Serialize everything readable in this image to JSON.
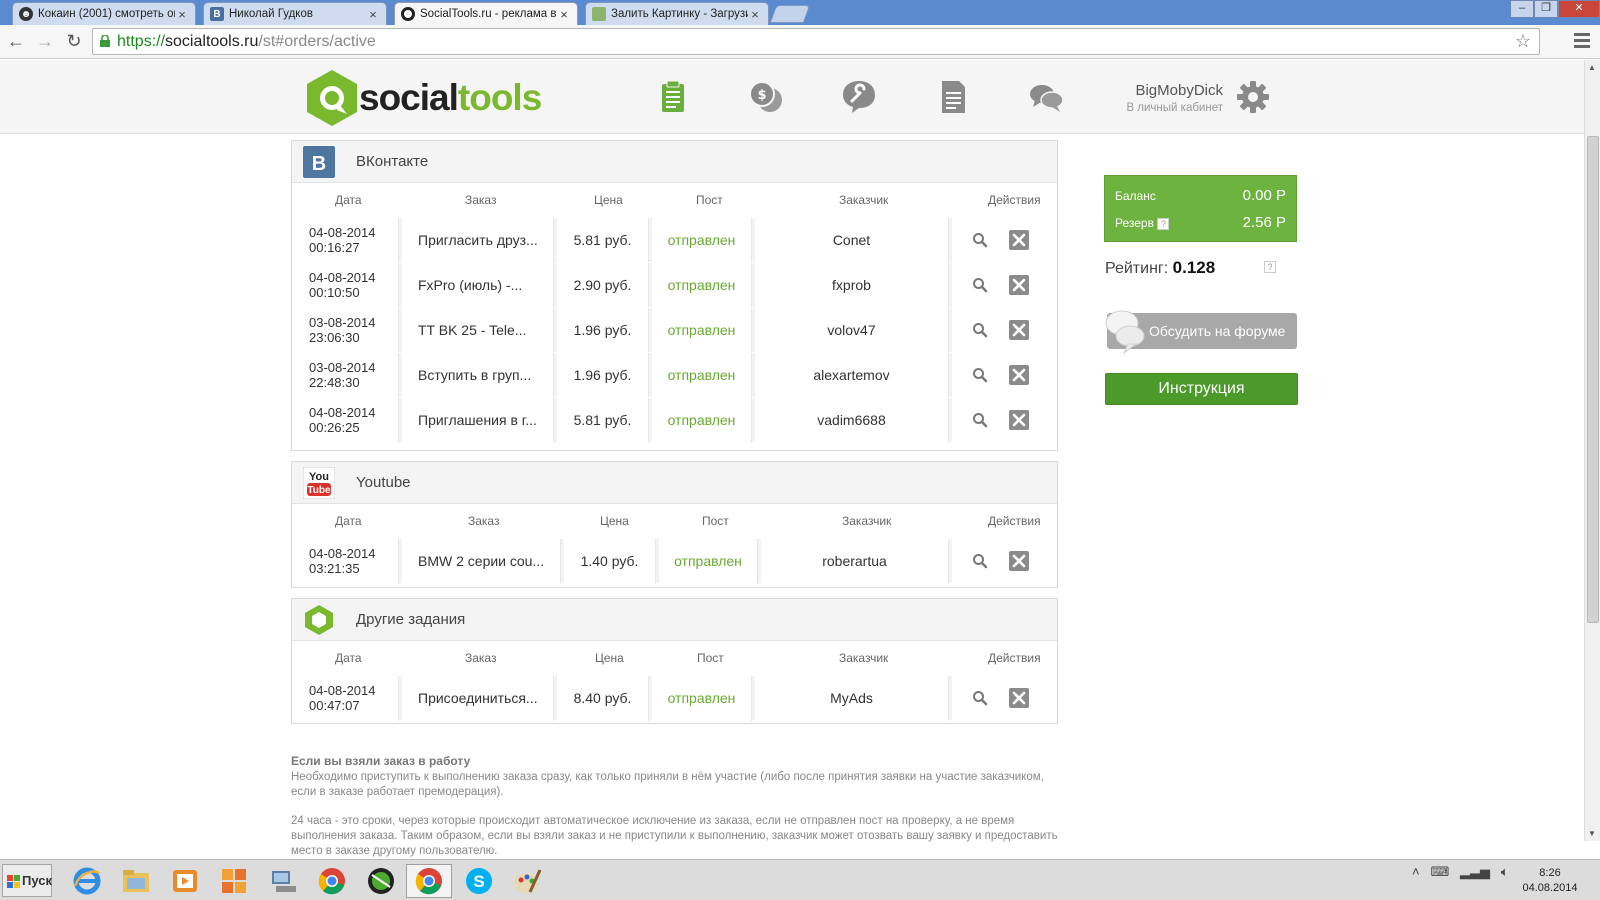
{
  "browser": {
    "tabs": [
      {
        "title": "Кокаин (2001) смотреть он",
        "close": "×"
      },
      {
        "title": "Николай Гудков",
        "close": "×"
      },
      {
        "title": "SocialTools.ru - реклама в с",
        "close": "×"
      },
      {
        "title": "Залить Картинку - Загрузи",
        "close": "×"
      }
    ],
    "url_proto": "https://",
    "url_host": "socialtools.ru",
    "url_path": "/st#orders/active"
  },
  "header": {
    "logo_part1": "social",
    "logo_part2": "tools",
    "user_name": "BigMobyDick",
    "user_link": "В личный кабинет"
  },
  "columns": {
    "date": "Дата",
    "order": "Заказ",
    "price": "Цена",
    "post": "Пост",
    "customer": "Заказчик",
    "actions": "Действия"
  },
  "sections": {
    "vk": {
      "title": "ВКонтакте",
      "rows": [
        {
          "date": "04-08-2014",
          "time": "00:16:27",
          "order": "Пригласить друз...",
          "price": "5.81 руб.",
          "post": "отправлен",
          "customer": "Conet"
        },
        {
          "date": "04-08-2014",
          "time": "00:10:50",
          "order": "FxPro (июль) -...",
          "price": "2.90 руб.",
          "post": "отправлен",
          "customer": "fxprob"
        },
        {
          "date": "03-08-2014",
          "time": "23:06:30",
          "order": "TT BK 25 - Tele...",
          "price": "1.96 руб.",
          "post": "отправлен",
          "customer": "volov47"
        },
        {
          "date": "03-08-2014",
          "time": "22:48:30",
          "order": "Вступить в груп...",
          "price": "1.96 руб.",
          "post": "отправлен",
          "customer": "alexartemov"
        },
        {
          "date": "04-08-2014",
          "time": "00:26:25",
          "order": "Приглашения в г...",
          "price": "5.81 руб.",
          "post": "отправлен",
          "customer": "vadim6688"
        }
      ]
    },
    "youtube": {
      "title": "Youtube",
      "rows": [
        {
          "date": "04-08-2014",
          "time": "03:21:35",
          "order": "BMW 2 серии cou...",
          "price": "1.40 руб.",
          "post": "отправлен",
          "customer": "roberartua"
        }
      ]
    },
    "other": {
      "title": "Другие задания",
      "rows": [
        {
          "date": "04-08-2014",
          "time": "00:47:07",
          "order": "Присоединиться...",
          "price": "8.40 руб.",
          "post": "отправлен",
          "customer": "MyAds"
        }
      ]
    }
  },
  "sidebar": {
    "balance_label": "Баланс",
    "balance_value": "0.00 Р",
    "reserve_label": "Резерв",
    "reserve_value": "2.56 Р",
    "help_mark": "?",
    "rating_label": "Рейтинг:",
    "rating_value": "0.128",
    "forum_button": "Обсудить на форуме",
    "instruction_button": "Инструкция"
  },
  "info": {
    "title": "Если вы взяли заказ в работу",
    "paragraph1": "Необходимо приступить к выполнению заказа сразу, как только приняли в нём участие (либо после принятия заявки на участие заказчиком, если в заказе работает премодерация).",
    "paragraph2": "24 часа - это сроки, через которые происходит автоматическое исключение из заказа, если не отправлен пост на проверку, а не время выполнения заказа. Таким образом, если вы взяли заказ и не приступили к выполнению, заказчик может отозвать вашу заявку и предоставить место в заказе другому пользователю."
  },
  "taskbar": {
    "start_label": "Пуск",
    "clock_time": "8:26",
    "clock_date": "04.08.2014"
  },
  "colors": {
    "brand_green": "#7ab82e",
    "balance_bg": "#6db33f",
    "instruction_bg": "#4c9a2a",
    "post_sent": "#6aa832"
  }
}
